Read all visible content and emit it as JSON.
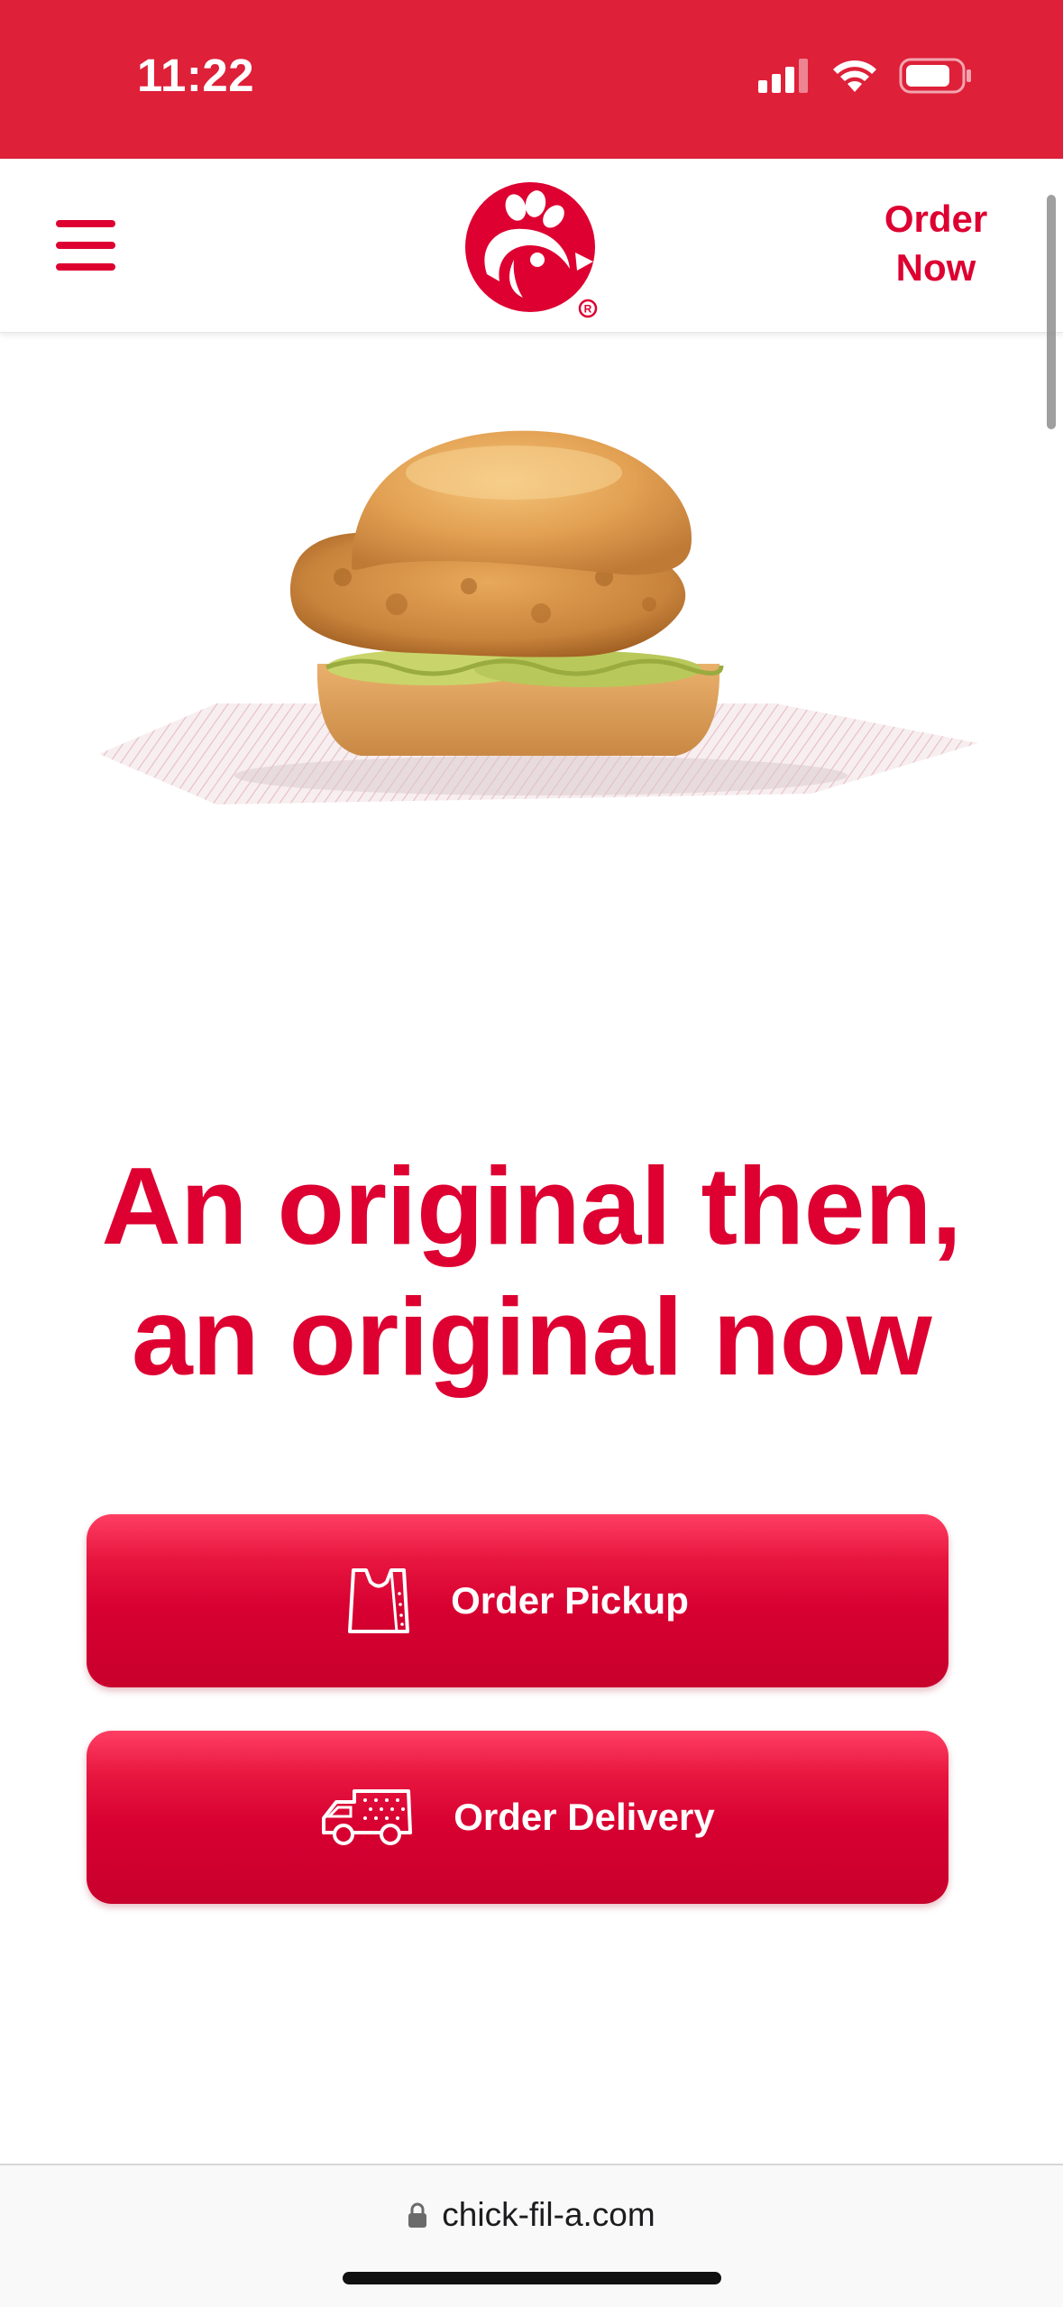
{
  "status_bar": {
    "time": "11:22",
    "background": "#de2039",
    "icons": [
      "signal-icon",
      "wifi-icon",
      "battery-icon"
    ]
  },
  "header": {
    "menu_icon": "hamburger-menu-icon",
    "logo_icon": "chick-fil-a-logo-icon",
    "order_now_line1": "Order",
    "order_now_line2": "Now"
  },
  "hero": {
    "image_icon": "chicken-sandwich-illustration",
    "headline_line1": "An original then,",
    "headline_line2": "an original now"
  },
  "actions": {
    "pickup_label": "Order Pickup",
    "pickup_icon": "pickup-bag-icon",
    "delivery_label": "Order Delivery",
    "delivery_icon": "delivery-van-icon"
  },
  "browser": {
    "url": "chick-fil-a.com",
    "lock_icon": "lock-icon"
  },
  "colors": {
    "brand_red": "#dd0031",
    "status_red": "#de2039",
    "white": "#ffffff"
  }
}
